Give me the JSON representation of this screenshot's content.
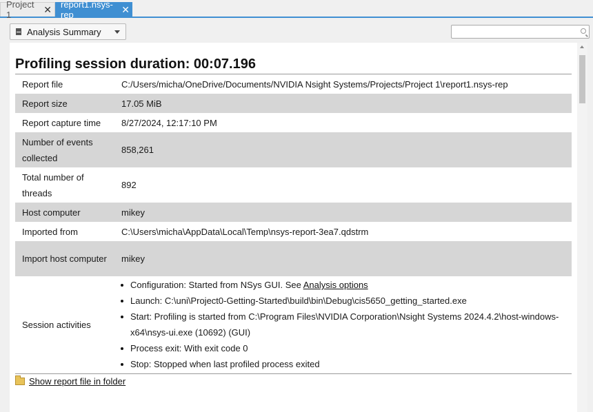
{
  "tabs": [
    {
      "label": "Project 1",
      "active": false
    },
    {
      "label": "report1.nsys-rep",
      "active": true
    }
  ],
  "toolbar": {
    "view_selector": "Analysis Summary",
    "search_placeholder": ""
  },
  "summary": {
    "title": "Profiling session duration: 00:07.196",
    "rows": [
      {
        "key": "Report file",
        "value": "C:/Users/micha/OneDrive/Documents/NVIDIA Nsight Systems/Projects/Project 1\\report1.nsys-rep"
      },
      {
        "key": "Report size",
        "value": "17.05 MiB"
      },
      {
        "key": "Report capture time",
        "value": "8/27/2024, 12:17:10 PM"
      },
      {
        "key": "Number of events collected",
        "value": "858,261"
      },
      {
        "key": "Total number of threads",
        "value": "892"
      },
      {
        "key": "Host computer",
        "value": "mikey"
      },
      {
        "key": "Imported from",
        "value": "C:\\Users\\micha\\AppData\\Local\\Temp\\nsys-report-3ea7.qdstrm"
      },
      {
        "key": "Import host computer",
        "value": "mikey"
      }
    ],
    "session_activities": {
      "key": "Session activities",
      "items": [
        {
          "text": "Configuration: Started from NSys GUI. See ",
          "link": "Analysis options"
        },
        {
          "text": "Launch: C:\\uni\\Project0-Getting-Started\\build\\bin\\Debug\\cis5650_getting_started.exe"
        },
        {
          "text": "Start: Profiling is started from C:\\Program Files\\NVIDIA Corporation\\Nsight Systems 2024.4.2\\host-windows-x64\\nsys-ui.exe (10692) (GUI)"
        },
        {
          "text": "Process exit: With exit code 0"
        },
        {
          "text": "Stop: Stopped when last profiled process exited"
        }
      ]
    },
    "footer_link": "Show report file in folder"
  },
  "icons": {
    "tab_close": "close-icon",
    "view_selector": "document-icon",
    "search": "search-icon",
    "folder": "folder-icon"
  }
}
